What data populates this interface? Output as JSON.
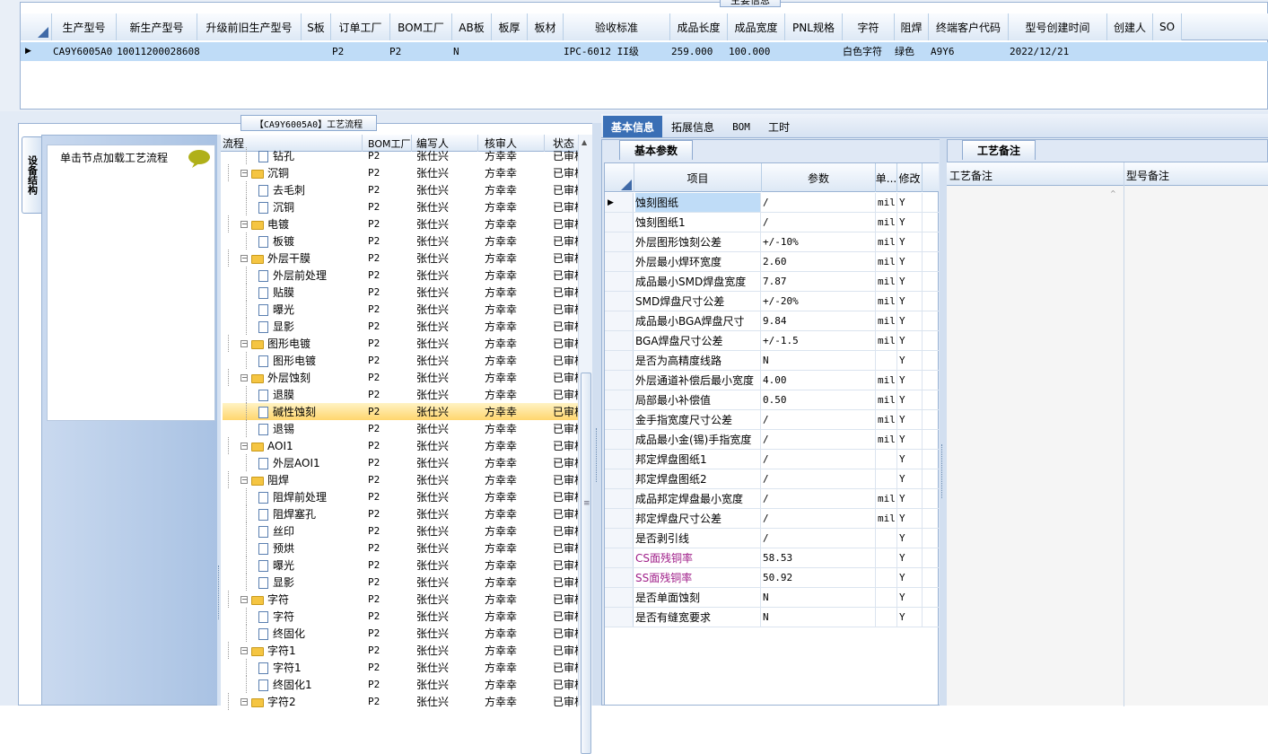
{
  "top_panel": {
    "title": "主要信息",
    "columns": [
      "生产型号",
      "新生产型号",
      "升级前旧生产型号",
      "S板",
      "订单工厂",
      "BOM工厂",
      "AB板",
      "板厚",
      "板材",
      "验收标准",
      "成品长度",
      "成品宽度",
      "PNL规格",
      "字符",
      "阻焊",
      "终端客户代码",
      "型号创建时间",
      "创建人",
      "SO"
    ],
    "row": {
      "prod_model": "CA9Y6005A0",
      "new_model": "10011200028608",
      "order_factory": "P2",
      "bom_factory": "P2",
      "ab_board": "N",
      "standard": "IPC-6012 II级",
      "length": "259.000",
      "width": "100.000",
      "char": "白色字符",
      "solder_mask": "绿色",
      "customer_code": "A9Y6",
      "created": "2022/12/21"
    }
  },
  "left_sidebar": {
    "vertical_tab": "设备结构",
    "hint": "单击节点加载工艺流程"
  },
  "flow_panel": {
    "title": "【CA9Y6005A0】工艺流程",
    "columns": [
      "流程",
      "BOM工厂",
      "编写人",
      "核审人",
      "状态"
    ],
    "rows": [
      {
        "level": 2,
        "name": "钻孔",
        "bom": "P2",
        "writer": "张仕兴",
        "reviewer": "方幸幸",
        "status": "已审核"
      },
      {
        "level": 1,
        "name": "沉铜",
        "bom": "P2",
        "writer": "张仕兴",
        "reviewer": "方幸幸",
        "status": "已审核"
      },
      {
        "level": 2,
        "name": "去毛刺",
        "bom": "P2",
        "writer": "张仕兴",
        "reviewer": "方幸幸",
        "status": "已审核"
      },
      {
        "level": 2,
        "name": "沉铜",
        "bom": "P2",
        "writer": "张仕兴",
        "reviewer": "方幸幸",
        "status": "已审核"
      },
      {
        "level": 1,
        "name": "电镀",
        "bom": "P2",
        "writer": "张仕兴",
        "reviewer": "方幸幸",
        "status": "已审核"
      },
      {
        "level": 2,
        "name": "板镀",
        "bom": "P2",
        "writer": "张仕兴",
        "reviewer": "方幸幸",
        "status": "已审核"
      },
      {
        "level": 1,
        "name": "外层干膜",
        "bom": "P2",
        "writer": "张仕兴",
        "reviewer": "方幸幸",
        "status": "已审核"
      },
      {
        "level": 2,
        "name": "外层前处理",
        "bom": "P2",
        "writer": "张仕兴",
        "reviewer": "方幸幸",
        "status": "已审核"
      },
      {
        "level": 2,
        "name": "贴膜",
        "bom": "P2",
        "writer": "张仕兴",
        "reviewer": "方幸幸",
        "status": "已审核"
      },
      {
        "level": 2,
        "name": "曝光",
        "bom": "P2",
        "writer": "张仕兴",
        "reviewer": "方幸幸",
        "status": "已审核"
      },
      {
        "level": 2,
        "name": "显影",
        "bom": "P2",
        "writer": "张仕兴",
        "reviewer": "方幸幸",
        "status": "已审核"
      },
      {
        "level": 1,
        "name": "图形电镀",
        "bom": "P2",
        "writer": "张仕兴",
        "reviewer": "方幸幸",
        "status": "已审核"
      },
      {
        "level": 2,
        "name": "图形电镀",
        "bom": "P2",
        "writer": "张仕兴",
        "reviewer": "方幸幸",
        "status": "已审核"
      },
      {
        "level": 1,
        "name": "外层蚀刻",
        "bom": "P2",
        "writer": "张仕兴",
        "reviewer": "方幸幸",
        "status": "已审核"
      },
      {
        "level": 2,
        "name": "退膜",
        "bom": "P2",
        "writer": "张仕兴",
        "reviewer": "方幸幸",
        "status": "已审核"
      },
      {
        "level": 2,
        "name": "碱性蚀刻",
        "bom": "P2",
        "writer": "张仕兴",
        "reviewer": "方幸幸",
        "status": "已审核",
        "selected": true
      },
      {
        "level": 2,
        "name": "退锡",
        "bom": "P2",
        "writer": "张仕兴",
        "reviewer": "方幸幸",
        "status": "已审核"
      },
      {
        "level": 1,
        "name": "AOI1",
        "bom": "P2",
        "writer": "张仕兴",
        "reviewer": "方幸幸",
        "status": "已审核"
      },
      {
        "level": 2,
        "name": "外层AOI1",
        "bom": "P2",
        "writer": "张仕兴",
        "reviewer": "方幸幸",
        "status": "已审核"
      },
      {
        "level": 1,
        "name": "阻焊",
        "bom": "P2",
        "writer": "张仕兴",
        "reviewer": "方幸幸",
        "status": "已审核"
      },
      {
        "level": 2,
        "name": "阻焊前处理",
        "bom": "P2",
        "writer": "张仕兴",
        "reviewer": "方幸幸",
        "status": "已审核"
      },
      {
        "level": 2,
        "name": "阻焊塞孔",
        "bom": "P2",
        "writer": "张仕兴",
        "reviewer": "方幸幸",
        "status": "已审核"
      },
      {
        "level": 2,
        "name": "丝印",
        "bom": "P2",
        "writer": "张仕兴",
        "reviewer": "方幸幸",
        "status": "已审核"
      },
      {
        "level": 2,
        "name": "预烘",
        "bom": "P2",
        "writer": "张仕兴",
        "reviewer": "方幸幸",
        "status": "已审核"
      },
      {
        "level": 2,
        "name": "曝光",
        "bom": "P2",
        "writer": "张仕兴",
        "reviewer": "方幸幸",
        "status": "已审核"
      },
      {
        "level": 2,
        "name": "显影",
        "bom": "P2",
        "writer": "张仕兴",
        "reviewer": "方幸幸",
        "status": "已审核"
      },
      {
        "level": 1,
        "name": "字符",
        "bom": "P2",
        "writer": "张仕兴",
        "reviewer": "方幸幸",
        "status": "已审核"
      },
      {
        "level": 2,
        "name": "字符",
        "bom": "P2",
        "writer": "张仕兴",
        "reviewer": "方幸幸",
        "status": "已审核"
      },
      {
        "level": 2,
        "name": "终固化",
        "bom": "P2",
        "writer": "张仕兴",
        "reviewer": "方幸幸",
        "status": "已审核"
      },
      {
        "level": 1,
        "name": "字符1",
        "bom": "P2",
        "writer": "张仕兴",
        "reviewer": "方幸幸",
        "status": "已审核"
      },
      {
        "level": 2,
        "name": "字符1",
        "bom": "P2",
        "writer": "张仕兴",
        "reviewer": "方幸幸",
        "status": "已审核"
      },
      {
        "level": 2,
        "name": "终固化1",
        "bom": "P2",
        "writer": "张仕兴",
        "reviewer": "方幸幸",
        "status": "已审核"
      },
      {
        "level": 1,
        "name": "字符2",
        "bom": "P2",
        "writer": "张仕兴",
        "reviewer": "方幸幸",
        "status": "已审核"
      }
    ]
  },
  "detail_tabs": [
    "基本信息",
    "拓展信息",
    "BOM",
    "工时"
  ],
  "basic_params": {
    "title": "基本参数",
    "columns": [
      "项目",
      "参数",
      "单...",
      "修改"
    ],
    "rows": [
      {
        "item": "蚀刻图纸",
        "value": "/",
        "unit": "mil",
        "mod": "Y"
      },
      {
        "item": "蚀刻图纸1",
        "value": "/",
        "unit": "mil",
        "mod": "Y"
      },
      {
        "item": "外层图形蚀刻公差",
        "value": "+/-10%",
        "unit": "mil",
        "mod": "Y"
      },
      {
        "item": "外层最小焊环宽度",
        "value": "2.60",
        "unit": "mil",
        "mod": "Y"
      },
      {
        "item": "成品最小SMD焊盘宽度",
        "value": "7.87",
        "unit": "mil",
        "mod": "Y"
      },
      {
        "item": "SMD焊盘尺寸公差",
        "value": "+/-20%",
        "unit": "mil",
        "mod": "Y"
      },
      {
        "item": "成品最小BGA焊盘尺寸",
        "value": "9.84",
        "unit": "mil",
        "mod": "Y"
      },
      {
        "item": "BGA焊盘尺寸公差",
        "value": "+/-1.5",
        "unit": "mil",
        "mod": "Y"
      },
      {
        "item": "是否为高精度线路",
        "value": "N",
        "unit": "",
        "mod": "Y"
      },
      {
        "item": "外层通道补偿后最小宽度",
        "value": "4.00",
        "unit": "mil",
        "mod": "Y"
      },
      {
        "item": "局部最小补偿值",
        "value": "0.50",
        "unit": "mil",
        "mod": "Y"
      },
      {
        "item": "金手指宽度尺寸公差",
        "value": "/",
        "unit": "mil",
        "mod": "Y"
      },
      {
        "item": "成品最小金(锡)手指宽度",
        "value": "/",
        "unit": "mil",
        "mod": "Y"
      },
      {
        "item": "邦定焊盘图纸1",
        "value": "/",
        "unit": "",
        "mod": "Y"
      },
      {
        "item": "邦定焊盘图纸2",
        "value": "/",
        "unit": "",
        "mod": "Y"
      },
      {
        "item": "成品邦定焊盘最小宽度",
        "value": "/",
        "unit": "mil",
        "mod": "Y"
      },
      {
        "item": "邦定焊盘尺寸公差",
        "value": "/",
        "unit": "mil",
        "mod": "Y"
      },
      {
        "item": "是否剥引线",
        "value": "/",
        "unit": "",
        "mod": "Y"
      },
      {
        "item": "CS面残铜率",
        "value": "58.53",
        "unit": "",
        "mod": "Y",
        "highlight": true
      },
      {
        "item": "SS面残铜率",
        "value": "50.92",
        "unit": "",
        "mod": "Y",
        "highlight": true
      },
      {
        "item": "是否单面蚀刻",
        "value": "N",
        "unit": "",
        "mod": "Y"
      },
      {
        "item": "是否有缝宽要求",
        "value": "N",
        "unit": "",
        "mod": "Y"
      }
    ]
  },
  "process_notes": {
    "title": "工艺备注",
    "columns": [
      "工艺备注",
      "型号备注"
    ]
  },
  "colors": {
    "selected_row": "#bfdcf7",
    "tree_selected": "#ffd66e",
    "tab_active": "#3a6fb5",
    "highlight_text": "#a0208a"
  }
}
